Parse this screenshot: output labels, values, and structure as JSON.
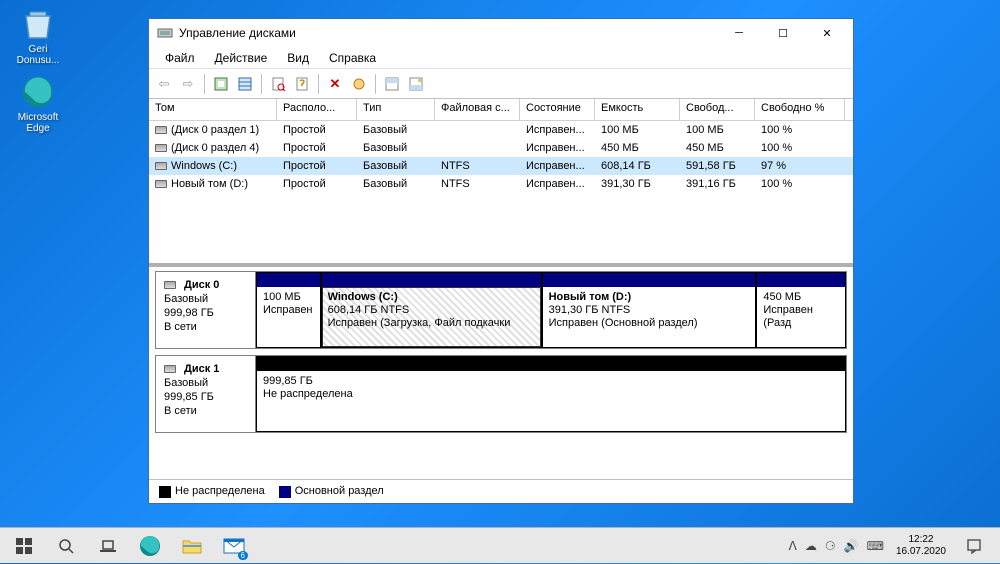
{
  "desktop": {
    "recycle_bin": "Geri Donusu...",
    "edge": "Microsoft Edge"
  },
  "window": {
    "title": "Управление дисками",
    "menu": {
      "file": "Файл",
      "action": "Действие",
      "view": "Вид",
      "help": "Справка"
    }
  },
  "columns": {
    "c0": "Том",
    "c1": "Располо...",
    "c2": "Тип",
    "c3": "Файловая с...",
    "c4": "Состояние",
    "c5": "Емкость",
    "c6": "Свобод...",
    "c7": "Свободно %"
  },
  "volumes": [
    {
      "name": "(Диск 0 раздел 1)",
      "layout": "Простой",
      "type": "Базовый",
      "fs": "",
      "status": "Исправен...",
      "capacity": "100 МБ",
      "free": "100 МБ",
      "pct": "100 %"
    },
    {
      "name": "(Диск 0 раздел 4)",
      "layout": "Простой",
      "type": "Базовый",
      "fs": "",
      "status": "Исправен...",
      "capacity": "450 МБ",
      "free": "450 МБ",
      "pct": "100 %"
    },
    {
      "name": "Windows (C:)",
      "layout": "Простой",
      "type": "Базовый",
      "fs": "NTFS",
      "status": "Исправен...",
      "capacity": "608,14 ГБ",
      "free": "591,58 ГБ",
      "pct": "97 %",
      "selected": true
    },
    {
      "name": "Новый том (D:)",
      "layout": "Простой",
      "type": "Базовый",
      "fs": "NTFS",
      "status": "Исправен...",
      "capacity": "391,30 ГБ",
      "free": "391,16 ГБ",
      "pct": "100 %"
    }
  ],
  "disks": [
    {
      "name": "Диск 0",
      "type": "Базовый",
      "size": "999,98 ГБ",
      "status": "В сети",
      "partitions": [
        {
          "title": "",
          "line1": "100 МБ",
          "line2": "Исправен",
          "klass": "primary",
          "flex": 10
        },
        {
          "title": "Windows  (C:)",
          "line1": "608,14 ГБ NTFS",
          "line2": "Исправен (Загрузка, Файл подкачки",
          "klass": "primary selected",
          "flex": 35
        },
        {
          "title": "Новый том  (D:)",
          "line1": "391,30 ГБ NTFS",
          "line2": "Исправен (Основной раздел)",
          "klass": "primary",
          "flex": 34
        },
        {
          "title": "",
          "line1": "450 МБ",
          "line2": "Исправен (Разд",
          "klass": "primary",
          "flex": 14
        }
      ]
    },
    {
      "name": "Диск 1",
      "type": "Базовый",
      "size": "999,85 ГБ",
      "status": "В сети",
      "partitions": [
        {
          "title": "",
          "line1": "999,85 ГБ",
          "line2": "Не распределена",
          "klass": "unalloc",
          "flex": 100
        }
      ]
    }
  ],
  "legend": {
    "unallocated": "Не распределена",
    "primary": "Основной раздел"
  },
  "taskbar": {
    "time": "12:22",
    "date": "16.07.2020",
    "mail_badge": "6"
  }
}
